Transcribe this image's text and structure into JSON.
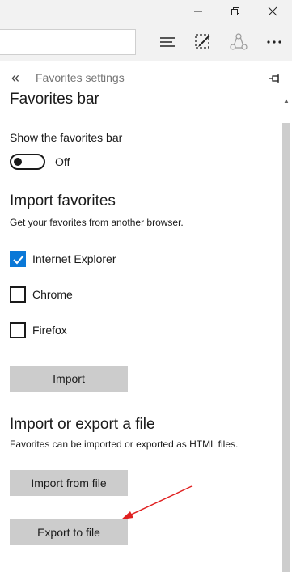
{
  "panel": {
    "title": "Favorites settings",
    "favorites_bar": {
      "heading": "Favorites bar",
      "show_label": "Show the favorites bar",
      "toggle_state": "Off"
    },
    "import": {
      "heading": "Import favorites",
      "description": "Get your favorites from another browser.",
      "browsers": [
        {
          "label": "Internet Explorer",
          "checked": true
        },
        {
          "label": "Chrome",
          "checked": false
        },
        {
          "label": "Firefox",
          "checked": false
        }
      ],
      "button_label": "Import"
    },
    "import_export": {
      "heading": "Import or export a file",
      "description": "Favorites can be imported or exported as HTML files.",
      "import_button": "Import from file",
      "export_button": "Export to file"
    }
  },
  "icons": {
    "titlebar": [
      "minimize-icon",
      "restore-icon",
      "close-icon"
    ],
    "toolbar": [
      "hub-icon",
      "web-note-icon",
      "share-icon",
      "more-icon"
    ],
    "panel": [
      "back-icon",
      "pin-icon"
    ]
  },
  "colors": {
    "accent": "#0a78d7",
    "button": "#cccccc",
    "arrow": "#e02020"
  }
}
